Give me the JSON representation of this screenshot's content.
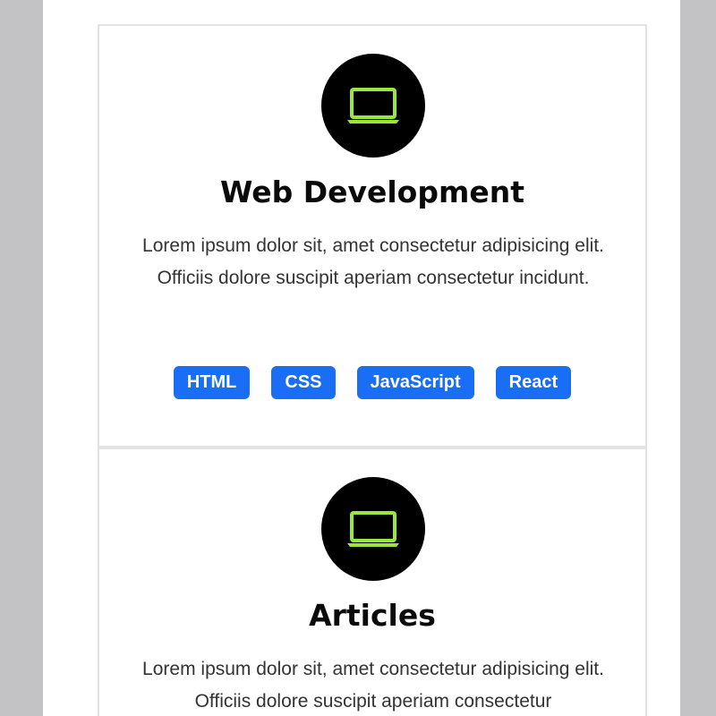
{
  "colors": {
    "background": "#c3c2c5",
    "page": "#ffffff",
    "icon_circle": "#000000",
    "icon_stroke": "#9be63a",
    "tag_background": "#1a6ef5",
    "tag_text": "#ffffff"
  },
  "cards": [
    {
      "icon": "laptop-icon",
      "title": "Web Development",
      "description": "Lorem ipsum dolor sit, amet consectetur adipisicing elit. Officiis dolore suscipit aperiam consectetur incidunt.",
      "tags": [
        "HTML",
        "CSS",
        "JavaScript",
        "React"
      ]
    },
    {
      "icon": "laptop-icon",
      "title": "Articles",
      "description": "Lorem ipsum dolor sit, amet consectetur adipisicing elit. Officiis dolore suscipit aperiam consectetur"
    }
  ]
}
